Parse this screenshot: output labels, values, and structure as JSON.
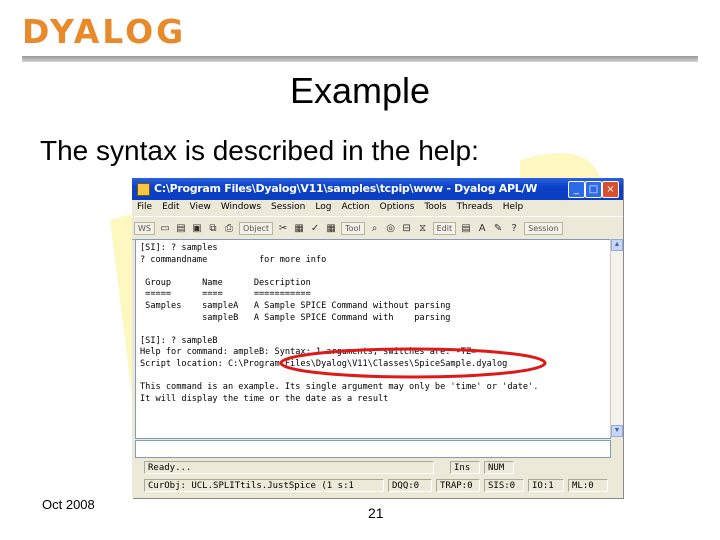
{
  "logo": {
    "text": "DYALOG"
  },
  "slide": {
    "title": "Example",
    "subtitle": "The syntax is described in the help:",
    "footer_date": "Oct  2008",
    "page_number": "21"
  },
  "colors": {
    "logo": "#e8892a",
    "watermark": "#fdf7c0",
    "highlight": "#e01818",
    "titlebar": "#0b41c7"
  },
  "window": {
    "title": "C:\\Program Files\\Dyalog\\V11\\samples\\tcpip\\www - Dyalog APL/W",
    "menu": [
      "File",
      "Edit",
      "View",
      "Windows",
      "Session",
      "Log",
      "Action",
      "Options",
      "Tools",
      "Threads",
      "Help"
    ],
    "toolbar": {
      "ws_label": "WS",
      "objects_label": "Object",
      "tool_label": "Tool",
      "edit_label": "Edit",
      "session_label": "Session"
    },
    "session_lines": [
      "[SI]: ? samples",
      "? commandname          for more info",
      "",
      " Group      Name      Description",
      " =====      ====      ===========",
      " Samples    sampleA   A Sample SPICE Command without parsing",
      "            sampleB   A Sample SPICE Command with    parsing",
      "",
      "[SI]: ? sampleB",
      "Help for command: ampleB: Syntax: 1 arguments; switches are: -TZ=",
      "Script location: C:\\Program Files\\Dyalog\\V11\\Classes\\SpiceSample.dyalog",
      "",
      "This command is an example. Its single argument may only be 'time' or 'date'.",
      "It will display the time or the date as a result"
    ],
    "status": {
      "ready": "Ready...",
      "ins": "Ins",
      "num": "NUM",
      "curobj": "CurObj: UCL.SPLITtils.JustSpice (1 s:1",
      "dqq": "DQQ:0",
      "trap": "TRAP:0",
      "sis": "SIS:0",
      "io": "IO:1",
      "ml": "ML:0"
    }
  }
}
